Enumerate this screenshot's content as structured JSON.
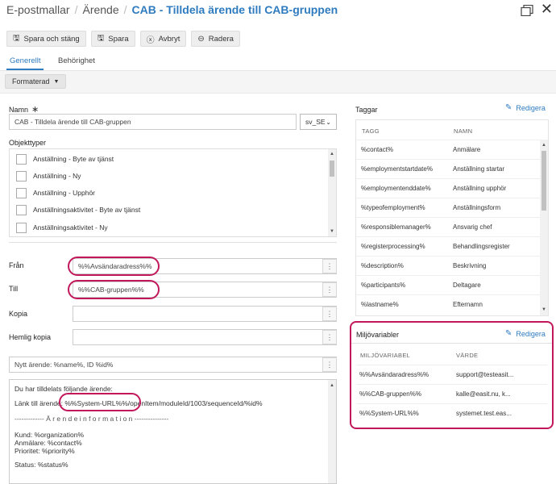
{
  "breadcrumb": {
    "part1": "E-postmallar",
    "part2": "Ärende",
    "current": "CAB - Tilldela ärende till CAB-gruppen"
  },
  "toolbar": {
    "save_close": "Spara och stäng",
    "save": "Spara",
    "cancel": "Avbryt",
    "delete": "Radera"
  },
  "tabs": {
    "general": "Generellt",
    "permissions": "Behörighet"
  },
  "format": {
    "label": "Formaterad"
  },
  "form": {
    "name_label": "Namn",
    "name_required": "∗",
    "name_value": "CAB - Tilldela ärende till CAB-gruppen",
    "language": "sv_SE",
    "objecttypes_label": "Objekttyper",
    "objecttypes": [
      "Anställning - Byte av tjänst",
      "Anställning - Ny",
      "Anställning - Upphör",
      "Anställningsaktivitet - Byte av tjänst",
      "Anställningsaktivitet - Ny"
    ],
    "from_label": "Från",
    "from_value": "%%Avsändaradress%%",
    "to_label": "Till",
    "to_value": "%%CAB-gruppen%%",
    "cc_label": "Kopia",
    "cc_value": "",
    "bcc_label": "Hemlig kopia",
    "bcc_value": "",
    "subject_value": "Nytt ärende: %name%, ID %id%",
    "field_btn": "⋮"
  },
  "body": {
    "line1": "Du har tilldelats följande ärende:",
    "line2_prefix": "Länk till ärende: ",
    "line2_highlight": "%%System-URL%%",
    "line2_suffix": "/openItem/moduleId/1003/sequenceId/%id%",
    "line3": "------------- Ä r e n d e i n f o r m a t i o n ---------------",
    "line4": "Kund: %organization%",
    "line5": "Anmälare: %contact%",
    "line6": "Prioritet: %priority%",
    "line7": "Status: %status%"
  },
  "tags": {
    "title": "Taggar",
    "edit": "Redigera",
    "col_tag": "TAGG",
    "col_name": "NAMN",
    "rows": [
      {
        "tag": "%contact%",
        "name": "Anmälare"
      },
      {
        "tag": "%employmentstartdate%",
        "name": "Anställning startar"
      },
      {
        "tag": "%employmentenddate%",
        "name": "Anställning upphör"
      },
      {
        "tag": "%typeofemployment%",
        "name": "Anställningsform"
      },
      {
        "tag": "%responsiblemanager%",
        "name": "Ansvarig chef"
      },
      {
        "tag": "%registerprocessing%",
        "name": "Behandlingsregister"
      },
      {
        "tag": "%description%",
        "name": "Beskrivning"
      },
      {
        "tag": "%participants%",
        "name": "Deltagare"
      },
      {
        "tag": "%lastname%",
        "name": "Efternamn"
      }
    ]
  },
  "env": {
    "title": "Miljövariabler",
    "edit": "Redigera",
    "col_var": "MILJÖVARIABEL",
    "col_val": "VÄRDE",
    "rows": [
      {
        "var": "%%Avsändaradress%%",
        "val": "support@testeasit..."
      },
      {
        "var": "%%CAB-gruppen%%",
        "val": "kalle@easit.nu, k..."
      },
      {
        "var": "%%System-URL%%",
        "val": "systemet.test.eas..."
      }
    ]
  },
  "colors": {
    "accent": "#2e7bbf",
    "highlight": "#c2185b"
  }
}
